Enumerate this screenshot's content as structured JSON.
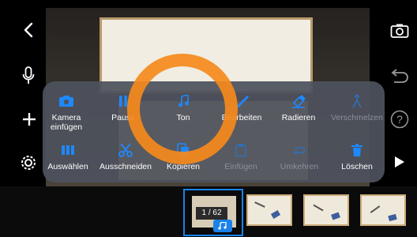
{
  "toolbar_left": {
    "back_icon": "chevron-left-icon",
    "mic_icon": "microphone-icon",
    "add_icon": "plus-icon",
    "settings_icon": "gear-icon"
  },
  "toolbar_right": {
    "camera_icon": "camera-icon",
    "undo_icon": "undo-icon",
    "help_label": "?",
    "play_icon": "play-icon"
  },
  "menu": {
    "row1": [
      {
        "label": "Kamera\neinfügen",
        "icon": "camera-icon",
        "enabled": true
      },
      {
        "label": "Pause",
        "icon": "pause-icon",
        "enabled": true
      },
      {
        "label": "Ton",
        "icon": "music-note-icon",
        "enabled": true
      },
      {
        "label": "Bearbeiten",
        "icon": "pen-icon",
        "enabled": true
      },
      {
        "label": "Radieren",
        "icon": "eraser-icon",
        "enabled": true
      },
      {
        "label": "Verschmelzen",
        "icon": "merge-icon",
        "enabled": false
      }
    ],
    "row2": [
      {
        "label": "Auswählen",
        "icon": "columns-icon",
        "enabled": true
      },
      {
        "label": "Ausschneiden",
        "icon": "scissors-icon",
        "enabled": true
      },
      {
        "label": "Kopieren",
        "icon": "copy-icon",
        "enabled": true
      },
      {
        "label": "Einfügen",
        "icon": "clipboard-icon",
        "enabled": false
      },
      {
        "label": "Umkehren",
        "icon": "reverse-icon",
        "enabled": false
      },
      {
        "label": "Löschen",
        "icon": "trash-icon",
        "enabled": true
      }
    ]
  },
  "filmstrip": {
    "counter": "1 / 62"
  },
  "colors": {
    "accent": "#1a82e8",
    "highlight_ring": "#f58a1c",
    "popup_bg": "#4e525c",
    "disabled": "#8c909a"
  }
}
